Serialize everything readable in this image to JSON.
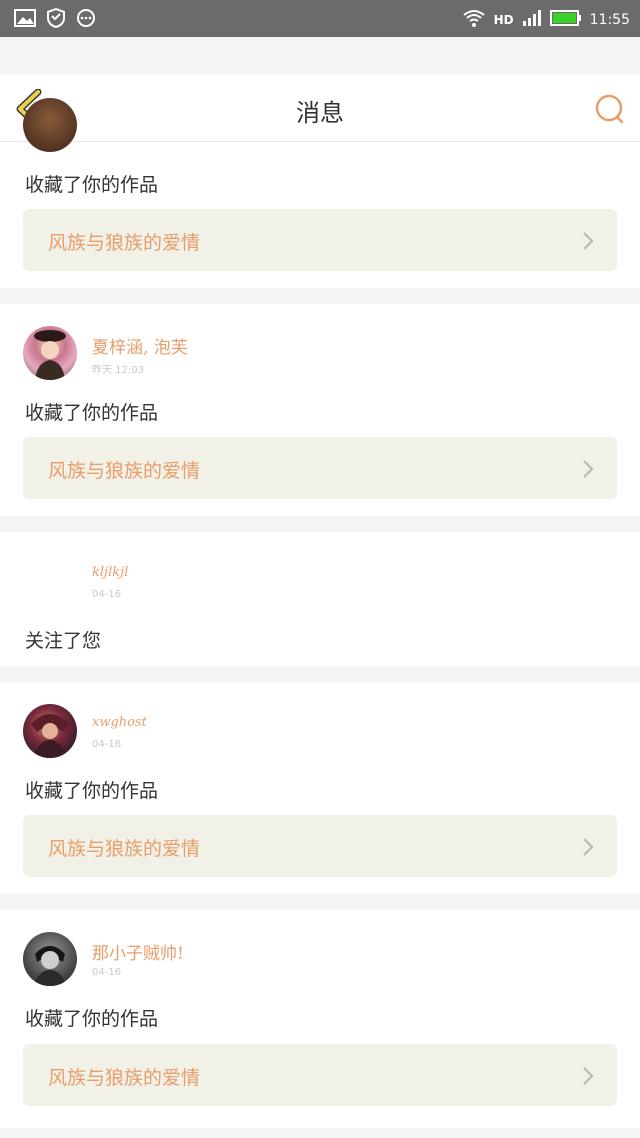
{
  "status_bar": {
    "time": "11:55",
    "network": "HD"
  },
  "header": {
    "title": "消息"
  },
  "messages": [
    {
      "action": "收藏了你的作品",
      "work_title": "风族与狼族的爱情"
    },
    {
      "username": "夏梓涵, 泡芙",
      "time": "昨天 12:03",
      "action": "收藏了你的作品",
      "work_title": "风族与狼族的爱情"
    },
    {
      "username": "kljlkjl",
      "time": "04-16",
      "action": "关注了您"
    },
    {
      "username": "xwghost",
      "time": "04-16",
      "action": "收藏了你的作品",
      "work_title": "风族与狼族的爱情"
    },
    {
      "username": "那小子贼帅!",
      "time": "04-16",
      "action": "收藏了你的作品",
      "work_title": "风族与狼族的爱情"
    }
  ],
  "colors": {
    "accent": "#e89e6a",
    "back_arrow": "#e7d24a",
    "work_bg": "#f2f1e8",
    "status_bar": "#6b6b6b"
  }
}
